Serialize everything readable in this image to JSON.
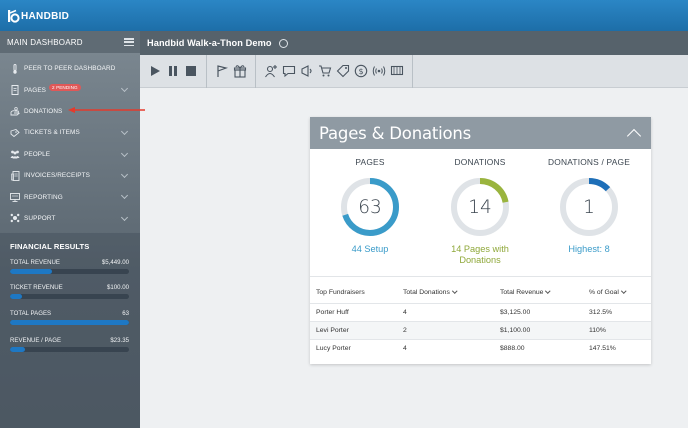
{
  "app": {
    "logo_text": "HANDBID",
    "event_title": "Handbid Walk-a-Thon Demo"
  },
  "sidebar": {
    "header": "MAIN DASHBOARD",
    "items": [
      {
        "label": "PEER TO PEER DASHBOARD",
        "icon": "thermometer-icon",
        "chevron": false
      },
      {
        "label": "PAGES",
        "icon": "document-icon",
        "chevron": true,
        "badge": "2 PENDING"
      },
      {
        "label": "DONATIONS",
        "icon": "donation-icon",
        "chevron": false
      },
      {
        "label": "TICKETS & ITEMS",
        "icon": "ticket-icon",
        "chevron": true
      },
      {
        "label": "PEOPLE",
        "icon": "people-icon",
        "chevron": true
      },
      {
        "label": "INVOICES/RECEIPTS",
        "icon": "invoice-icon",
        "chevron": true
      },
      {
        "label": "REPORTING",
        "icon": "report-icon",
        "chevron": true
      },
      {
        "label": "SUPPORT",
        "icon": "support-icon",
        "chevron": true
      }
    ]
  },
  "financial": {
    "title": "FINANCIAL RESULTS",
    "rows": [
      {
        "label": "TOTAL REVENUE",
        "value": "$5,449.00",
        "progress": 0.35
      },
      {
        "label": "TICKET REVENUE",
        "value": "$100.00",
        "progress": 0.1
      },
      {
        "label": "TOTAL PAGES",
        "value": "63",
        "progress": 1.0
      },
      {
        "label": "REVENUE / PAGE",
        "value": "$23.35",
        "progress": 0.13
      }
    ]
  },
  "toolbar": {
    "icons": [
      "play-icon",
      "pause-icon",
      "stop-icon",
      "flag-icon",
      "gift-icon",
      "add-user-icon",
      "chat-icon",
      "broadcast-icon",
      "cart-icon",
      "tag-icon",
      "dollar-icon",
      "signal-icon",
      "display-icon"
    ]
  },
  "colors": {
    "accent_blue": "#3a9bc9",
    "accent_green": "#9ab43e",
    "accent_navy": "#1e6fb8",
    "ring_track": "#dfe3e7"
  },
  "card": {
    "title": "Pages & Donations",
    "stats": [
      {
        "label": "PAGES",
        "value": "63",
        "sub": "44 Setup",
        "progress": 0.7,
        "color": "#3a9bc9"
      },
      {
        "label": "DONATIONS",
        "value": "14",
        "sub": "14 Pages with Donations",
        "progress": 0.22,
        "color": "#9ab43e"
      },
      {
        "label": "DONATIONS / PAGE",
        "value": "1",
        "sub": "Highest: 8",
        "progress": 0.13,
        "color": "#1e6fb8"
      }
    ],
    "table": {
      "headers": [
        "Top Fundraisers",
        "Total Donations",
        "Total Revenue",
        "% of Goal"
      ],
      "rows": [
        [
          "Porter Huff",
          "4",
          "$3,125.00",
          "312.5%"
        ],
        [
          "Levi Porter",
          "2",
          "$1,100.00",
          "110%"
        ],
        [
          "Lucy Porter",
          "4",
          "$888.00",
          "147.51%"
        ]
      ]
    }
  }
}
